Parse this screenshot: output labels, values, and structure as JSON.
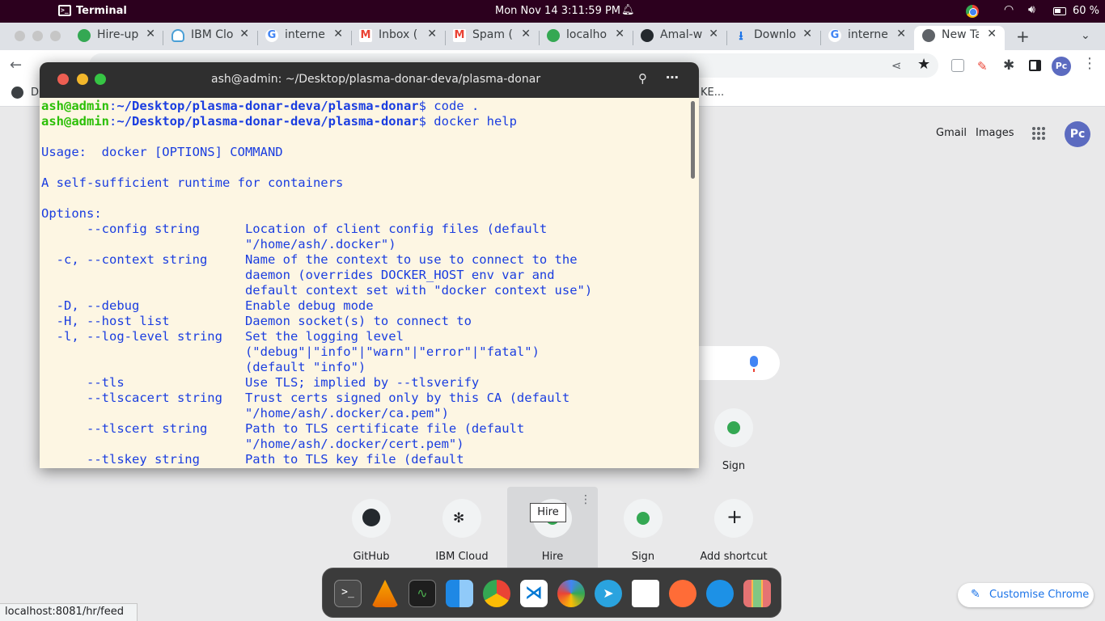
{
  "topbar": {
    "app_name": "Terminal",
    "clock": "Mon Nov 14   3:11:59 PM",
    "battery": "60 %"
  },
  "browser": {
    "tabs": [
      {
        "label": "Hire-up",
        "icon": "green-drop-icon"
      },
      {
        "label": "IBM Clo",
        "icon": "cloud-icon"
      },
      {
        "label": "interne",
        "icon": "google-g-icon"
      },
      {
        "label": "Inbox (",
        "icon": "gmail-icon"
      },
      {
        "label": "Spam (",
        "icon": "gmail-icon"
      },
      {
        "label": "localho",
        "icon": "green-drop-icon"
      },
      {
        "label": "Amal-w",
        "icon": "github-icon"
      },
      {
        "label": "Downlo",
        "icon": "download-icon"
      },
      {
        "label": "interne",
        "icon": "google-g-icon"
      },
      {
        "label": "New Ta",
        "icon": "chrome-icon",
        "active": true
      }
    ],
    "bookmark_left": "D",
    "bookmark_right": "KE...",
    "profile_initials": "Pc"
  },
  "ntp": {
    "gmail": "Gmail",
    "images": "Images",
    "profile_initials": "Pc",
    "top_row_labels": [
      "Sign"
    ],
    "tiles": [
      {
        "label": "GitHub",
        "icon": "github-icon"
      },
      {
        "label": "IBM Cloud",
        "icon": "ibm-bee-icon"
      },
      {
        "label": "Hire",
        "icon": "green-drop-icon"
      },
      {
        "label": "Sign",
        "icon": "green-drop-icon"
      },
      {
        "label": "Add shortcut",
        "icon": "plus-icon"
      }
    ],
    "tooltip": "Hire",
    "customise": "Customise Chrome"
  },
  "status_url": "localhost:8081/hr/feed",
  "terminal": {
    "title": "ash@admin: ~/Desktop/plasma-donar-deva/plasma-donar",
    "prompt_user": "ash@admin",
    "prompt_path": "~/Desktop/plasma-donar-deva/plasma-donar",
    "cmd1": "$ code .",
    "cmd2": "$ docker help",
    "output": "\nUsage:  docker [OPTIONS] COMMAND\n\nA self-sufficient runtime for containers\n\nOptions:\n      --config string      Location of client config files (default\n                           \"/home/ash/.docker\")\n  -c, --context string     Name of the context to use to connect to the\n                           daemon (overrides DOCKER_HOST env var and\n                           default context set with \"docker context use\")\n  -D, --debug              Enable debug mode\n  -H, --host list          Daemon socket(s) to connect to\n  -l, --log-level string   Set the logging level\n                           (\"debug\"|\"info\"|\"warn\"|\"error\"|\"fatal\")\n                           (default \"info\")\n      --tls                Use TLS; implied by --tlsverify\n      --tlscacert string   Trust certs signed only by this CA (default\n                           \"/home/ash/.docker/ca.pem\")\n      --tlscert string     Path to TLS certificate file (default\n                           \"/home/ash/.docker/cert.pem\")\n      --tlskey string      Path to TLS key file (default"
  },
  "dock": [
    "terminal-icon",
    "vlc-icon",
    "system-monitor-icon",
    "finder-icon",
    "chrome-icon",
    "vscode-icon",
    "photos-icon",
    "telegram-icon",
    "mongodb-compass-icon",
    "postman-icon",
    "docker-icon",
    "app-grid-icon"
  ]
}
